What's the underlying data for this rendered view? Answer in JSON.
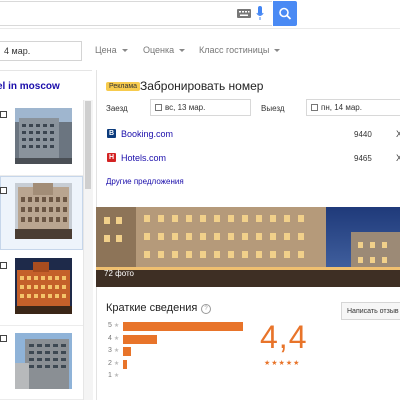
{
  "search": {
    "placeholder": ""
  },
  "filters": {
    "date_value": "4 мар.",
    "price_label": "Цена",
    "rating_label": "Оценка",
    "class_label": "Класс гостиницы"
  },
  "hotel_list": {
    "title": "el in moscow",
    "items": [
      {
        "thumb": "building-photo"
      },
      {
        "thumb": "building-photo",
        "selected": true
      },
      {
        "thumb": "building-photo"
      },
      {
        "thumb": "building-photo"
      }
    ]
  },
  "booking": {
    "ad_badge": "Реклама",
    "title": "Забронировать номер",
    "checkin_label": "Заезд",
    "checkin_value": "вс, 13 мар.",
    "checkout_label": "Выезд",
    "checkout_value": "пн, 14 мар.",
    "providers": [
      {
        "icon_text": "B",
        "icon_color": "#0c3b7c",
        "name": "Booking.com",
        "price": "9440",
        "close": "X"
      },
      {
        "icon_text": "H",
        "icon_color": "#d32323",
        "name": "Hotels.com",
        "price": "9465",
        "close": "X"
      }
    ],
    "more_offers": "Другие предложения"
  },
  "photos": {
    "count_label": "72 фото"
  },
  "summary": {
    "title": "Краткие сведения",
    "help_icon": "?",
    "review_button": "Написать отзыв",
    "rating": "4,4",
    "stars_text": "★★★★★",
    "accent_color": "#e8742a",
    "distribution": [
      {
        "stars": "5",
        "fraction": 1.0
      },
      {
        "stars": "4",
        "fraction": 0.28
      },
      {
        "stars": "3",
        "fraction": 0.07
      },
      {
        "stars": "2",
        "fraction": 0.02
      },
      {
        "stars": "1",
        "fraction": 0.0
      }
    ]
  }
}
